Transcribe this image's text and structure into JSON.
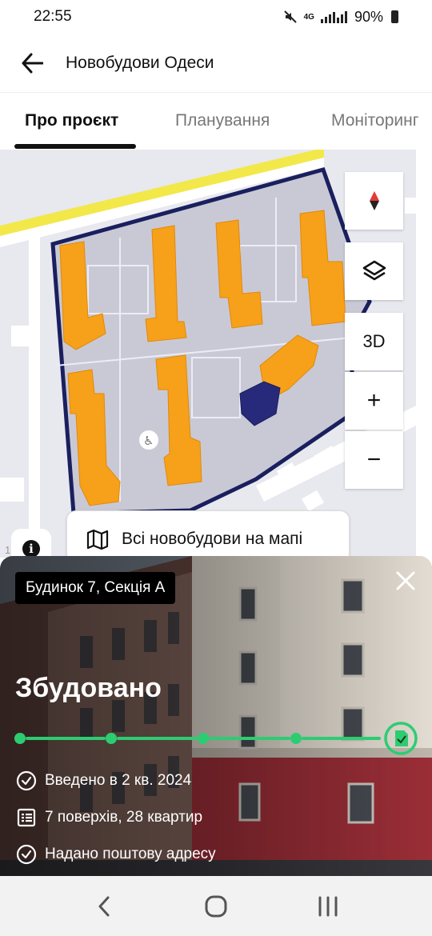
{
  "status_bar": {
    "time": "22:55",
    "network": "4G",
    "battery": "90%",
    "icons": [
      "mute-icon",
      "signal-icon",
      "battery-icon"
    ]
  },
  "header": {
    "title": "Новобудови Одеси",
    "back_icon": "arrow-left-icon"
  },
  "tabs": [
    {
      "label": "Про проєкт",
      "active": true
    },
    {
      "label": "Планування",
      "active": false
    },
    {
      "label": "Моніторинг",
      "active": false
    }
  ],
  "map": {
    "controls": {
      "compass_icon": "compass-icon",
      "layers_icon": "layers-icon",
      "mode_3d": "3D",
      "zoom_in": "+",
      "zoom_out": "−"
    },
    "all_buildings_button": "Всі новобудови на мапі",
    "info_icon": "info-icon",
    "colors": {
      "building": "#f7a01a",
      "selected_building": "#27297a",
      "boundary": "#1a1f5e",
      "road": "#f2e84a"
    }
  },
  "card": {
    "badge": "Будинок 7, Секція А",
    "status": "Збудовано",
    "progress_steps": 5,
    "progress_done": 5,
    "progress_color": "#2ecc71",
    "facts": [
      {
        "icon": "check-circle-icon",
        "text": "Введено в 2 кв. 2024"
      },
      {
        "icon": "list-icon",
        "text": "7 поверхів, 28 квартир"
      },
      {
        "icon": "check-circle-icon",
        "text": "Надано поштову адресу"
      }
    ]
  },
  "nav_bar": {
    "buttons": [
      "back-nav-icon",
      "home-nav-icon",
      "recents-nav-icon"
    ]
  }
}
